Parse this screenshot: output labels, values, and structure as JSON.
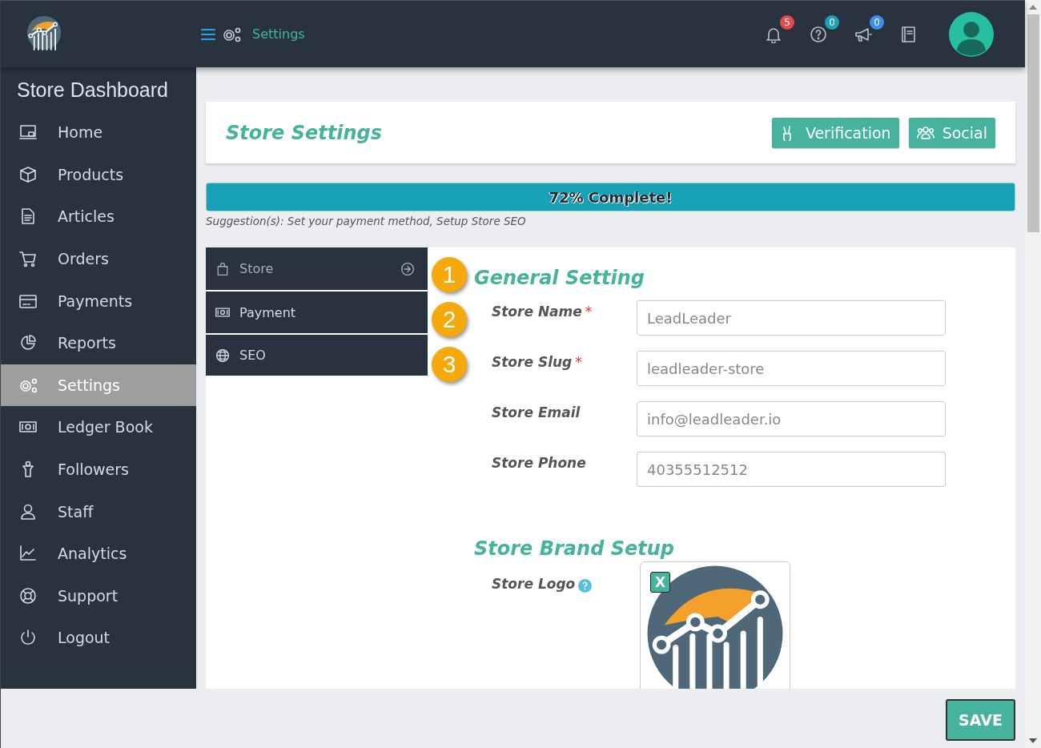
{
  "topbar": {
    "breadcrumb": "Settings",
    "notifications": [
      {
        "count": "5",
        "color": "#e8474c"
      },
      {
        "count": "0",
        "color": "#1aa3b8"
      },
      {
        "count": "0",
        "color": "#3c8ff0"
      }
    ]
  },
  "sidebar": {
    "title": "Store Dashboard",
    "items": [
      {
        "label": "Home",
        "selected": false
      },
      {
        "label": "Products",
        "selected": false
      },
      {
        "label": "Articles",
        "selected": false
      },
      {
        "label": "Orders",
        "selected": false
      },
      {
        "label": "Payments",
        "selected": false
      },
      {
        "label": "Reports",
        "selected": false
      },
      {
        "label": "Settings",
        "selected": true
      },
      {
        "label": "Ledger Book",
        "selected": false
      },
      {
        "label": "Followers",
        "selected": false
      },
      {
        "label": "Staff",
        "selected": false
      },
      {
        "label": "Analytics",
        "selected": false
      },
      {
        "label": "Support",
        "selected": false
      },
      {
        "label": "Logout",
        "selected": false
      }
    ]
  },
  "header": {
    "title": "Store Settings",
    "buttons": [
      "Verification",
      "Social"
    ]
  },
  "progress": {
    "label": "72% Complete!",
    "level": 1,
    "suggestion": "Suggestion(s): Set your payment method, Setup Store SEO"
  },
  "tabs": [
    {
      "label": "Store",
      "selected": true
    },
    {
      "label": "Payment",
      "selected": false
    },
    {
      "label": "SEO",
      "selected": false
    }
  ],
  "steps": [
    "1",
    "2",
    "3"
  ],
  "general": {
    "title": "General Setting",
    "required_mark": "*",
    "fields": [
      {
        "label": "Store Name",
        "required": true,
        "value": "LeadLeader"
      },
      {
        "label": "Store Slug",
        "required": true,
        "value": "leadleader-store"
      },
      {
        "label": "Store Email",
        "required": false,
        "value": "info@leadleader.io"
      },
      {
        "label": "Store Phone",
        "required": false,
        "value": "40355512512"
      }
    ]
  },
  "brand": {
    "title": "Store Brand Setup",
    "logo_label": "Store Logo",
    "remove": "X"
  },
  "save": "SAVE"
}
